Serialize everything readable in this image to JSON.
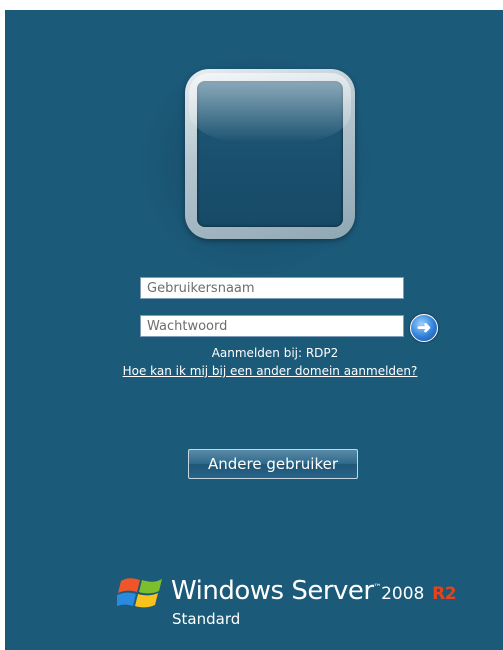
{
  "login": {
    "username_placeholder": "Gebruikersnaam",
    "password_placeholder": "Wachtwoord",
    "submit_arrow": "➜",
    "sign_in_to": "Aanmelden bij: RDP2",
    "other_domain_link": "Hoe kan ik mij bij een ander domein aanmelden?",
    "other_user_button": "Andere gebruiker"
  },
  "brand": {
    "name": "Windows Server",
    "version": "2008",
    "release": "R2",
    "edition": "Standard",
    "logo_icon": "windows-flag-icon"
  },
  "colors": {
    "background": "#1c5a7a",
    "accent_r2": "#e8421a",
    "arrow_button": "#2f7fd8"
  }
}
